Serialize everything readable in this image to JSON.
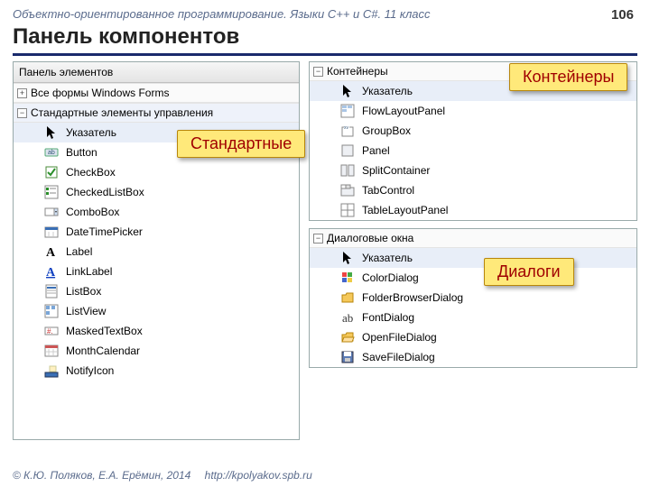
{
  "header": {
    "caption": "Объектно-ориентированное программирование. Языки С++ и C#. 11 класс",
    "page": "106",
    "title": "Панель компонентов"
  },
  "callouts": {
    "standard": "Стандартные",
    "containers": "Контейнеры",
    "dialogs": "Диалоги"
  },
  "left_panel": {
    "title": "Панель элементов",
    "group_all": "Все формы Windows Forms",
    "group_std": "Стандартные элементы управления",
    "items": [
      {
        "icon": "pointer",
        "label": "Указатель"
      },
      {
        "icon": "button",
        "label": "Button"
      },
      {
        "icon": "checkbox",
        "label": "CheckBox"
      },
      {
        "icon": "checkedlist",
        "label": "CheckedListBox"
      },
      {
        "icon": "combobox",
        "label": "ComboBox"
      },
      {
        "icon": "datetime",
        "label": "DateTimePicker"
      },
      {
        "icon": "label",
        "label": "Label"
      },
      {
        "icon": "linklabel",
        "label": "LinkLabel"
      },
      {
        "icon": "listbox",
        "label": "ListBox"
      },
      {
        "icon": "listview",
        "label": "ListView"
      },
      {
        "icon": "masked",
        "label": "MaskedTextBox"
      },
      {
        "icon": "calendar",
        "label": "MonthCalendar"
      },
      {
        "icon": "notify",
        "label": "NotifyIcon"
      }
    ]
  },
  "containers_panel": {
    "title": "Контейнеры",
    "items": [
      {
        "icon": "pointer",
        "label": "Указатель"
      },
      {
        "icon": "flow",
        "label": "FlowLayoutPanel"
      },
      {
        "icon": "groupbox",
        "label": "GroupBox"
      },
      {
        "icon": "panel",
        "label": "Panel"
      },
      {
        "icon": "split",
        "label": "SplitContainer"
      },
      {
        "icon": "tab",
        "label": "TabControl"
      },
      {
        "icon": "table",
        "label": "TableLayoutPanel"
      }
    ]
  },
  "dialogs_panel": {
    "title": "Диалоговые окна",
    "items": [
      {
        "icon": "pointer",
        "label": "Указатель"
      },
      {
        "icon": "color",
        "label": "ColorDialog"
      },
      {
        "icon": "folder",
        "label": "FolderBrowserDialog"
      },
      {
        "icon": "font",
        "label": "FontDialog"
      },
      {
        "icon": "open",
        "label": "OpenFileDialog"
      },
      {
        "icon": "save",
        "label": "SaveFileDialog"
      }
    ]
  },
  "footer": {
    "copyright": "© К.Ю. Поляков, Е.А. Ерёмин, 2014",
    "url": "http://kpolyakov.spb.ru"
  }
}
